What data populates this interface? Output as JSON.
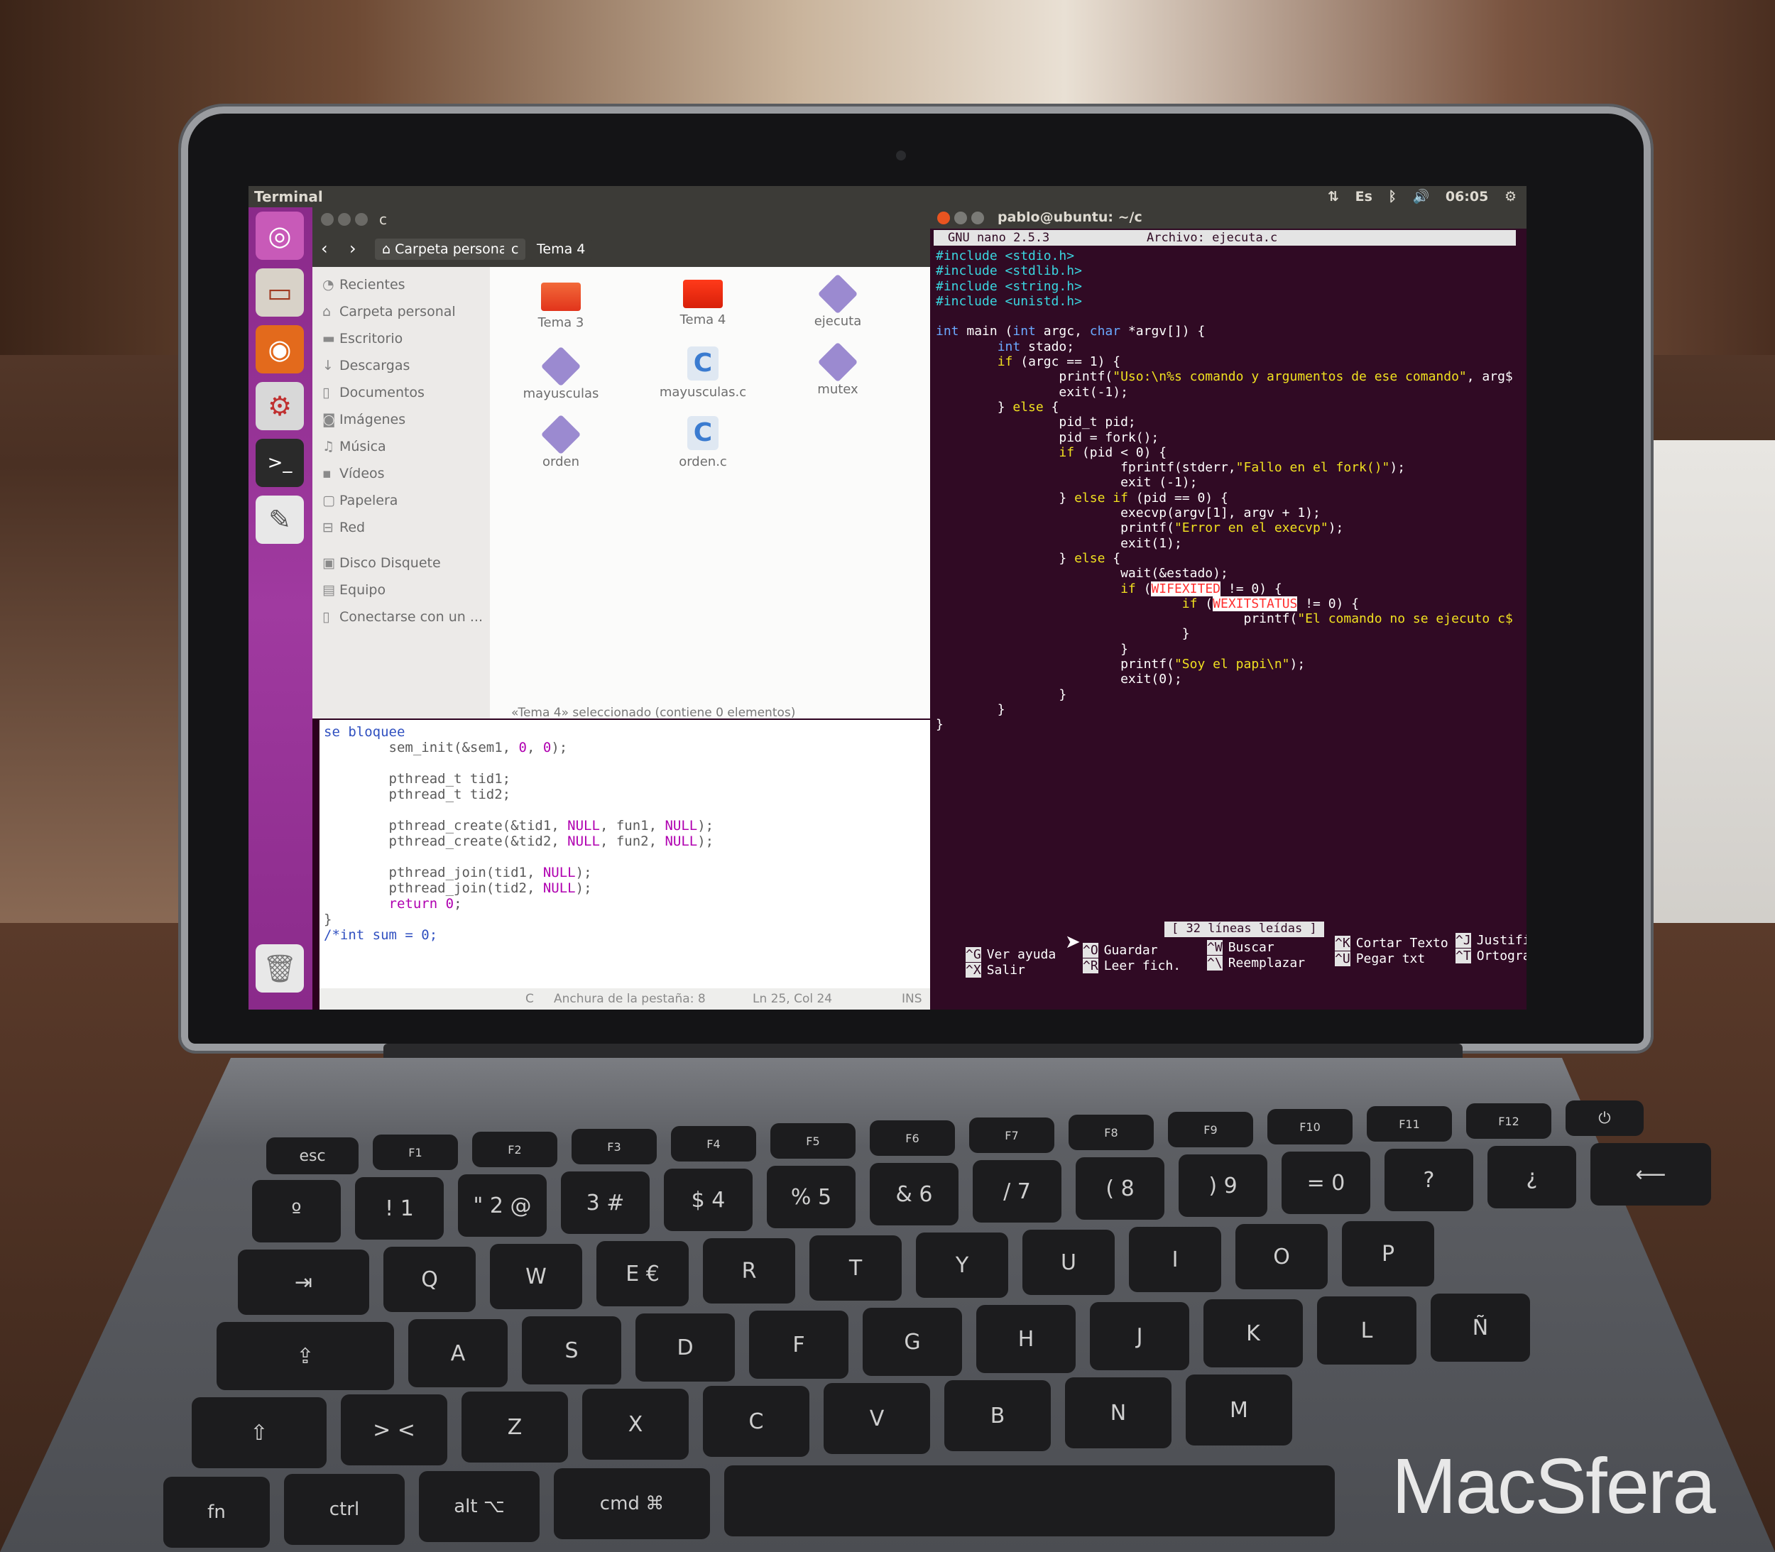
{
  "topbar": {
    "title": "Terminal",
    "lang": "Es",
    "time": "06:05"
  },
  "files": {
    "title": "c",
    "crumbs": [
      "Carpeta personal",
      "c",
      "Tema 4"
    ],
    "sidebar": [
      {
        "label": "Recientes",
        "icon": "clock-icon"
      },
      {
        "label": "Carpeta personal",
        "icon": "home-icon"
      },
      {
        "label": "Escritorio",
        "icon": "folder-icon"
      },
      {
        "label": "Descargas",
        "icon": "download-icon"
      },
      {
        "label": "Documentos",
        "icon": "document-icon"
      },
      {
        "label": "Imágenes",
        "icon": "camera-icon"
      },
      {
        "label": "Música",
        "icon": "music-icon"
      },
      {
        "label": "Vídeos",
        "icon": "film-icon"
      },
      {
        "label": "Papelera",
        "icon": "trash-icon"
      },
      {
        "label": "Red",
        "icon": "network-icon"
      },
      {
        "label": "Disco Disquete",
        "icon": "floppy-icon"
      },
      {
        "label": "Equipo",
        "icon": "computer-icon"
      },
      {
        "label": "Conectarse con un ...",
        "icon": "server-icon"
      }
    ],
    "items": [
      {
        "label": "Tema 3",
        "type": "folder"
      },
      {
        "label": "Tema 4",
        "type": "folder"
      },
      {
        "label": "ejecuta",
        "type": "exec"
      },
      {
        "label": "mayusculas",
        "type": "exec"
      },
      {
        "label": "mayusculas.c",
        "type": "c"
      },
      {
        "label": "mutex",
        "type": "exec"
      },
      {
        "label": "orden",
        "type": "exec"
      },
      {
        "label": "orden.c",
        "type": "c"
      }
    ],
    "status": "«Tema 4» seleccionado (contiene 0 elementos)"
  },
  "gedit": {
    "status_lang": "C",
    "status_tab": "Anchura de la pestaña: 8",
    "status_pos": "Ln 25, Col 24",
    "status_mode": "INS"
  },
  "terminal": {
    "title": "pablo@ubuntu: ~/c",
    "nano_version": "GNU nano 2.5.3",
    "file_label": "Archivo: ejecuta.c",
    "status_msg": "[ 32 líneas leídas ]",
    "shortcuts": [
      {
        "k1": "^G",
        "l1": "Ver ayuda",
        "k2": "^X",
        "l2": "Salir"
      },
      {
        "k1": "^O",
        "l1": "Guardar",
        "k2": "^R",
        "l2": "Leer fich."
      },
      {
        "k1": "^W",
        "l1": "Buscar",
        "k2": "^\\",
        "l2": "Reemplazar"
      },
      {
        "k1": "^K",
        "l1": "Cortar Texto",
        "k2": "^U",
        "l2": "Pegar txt"
      },
      {
        "k1": "^J",
        "l1": "Justificar",
        "k2": "^T",
        "l2": "Ortografía"
      }
    ]
  },
  "keyboard": {
    "row0": [
      "esc",
      "F1",
      "F2",
      "F3",
      "F4",
      "F5",
      "F6",
      "F7",
      "F8",
      "F9",
      "F10",
      "F11",
      "F12"
    ],
    "row1": [
      "º",
      "!  1",
      "\"  2 @",
      "3 #",
      "$  4",
      "%  5",
      "&  6",
      "/  7",
      "(  8",
      ")  9",
      "=  0",
      "?",
      "¿"
    ],
    "row2": [
      "⇥",
      "Q",
      "W",
      "E €",
      "R",
      "T",
      "Y",
      "U",
      "I",
      "O",
      "P"
    ],
    "row3": [
      "⇪",
      "A",
      "S",
      "D",
      "F",
      "G",
      "H",
      "J",
      "K",
      "L",
      "Ñ"
    ],
    "row4": [
      "⇧",
      "> <",
      "Z",
      "X",
      "C",
      "V",
      "B",
      "N",
      "M"
    ],
    "row5": [
      "fn",
      "ctrl",
      "alt ⌥",
      "cmd ⌘"
    ]
  },
  "watermark": "MacSfera"
}
